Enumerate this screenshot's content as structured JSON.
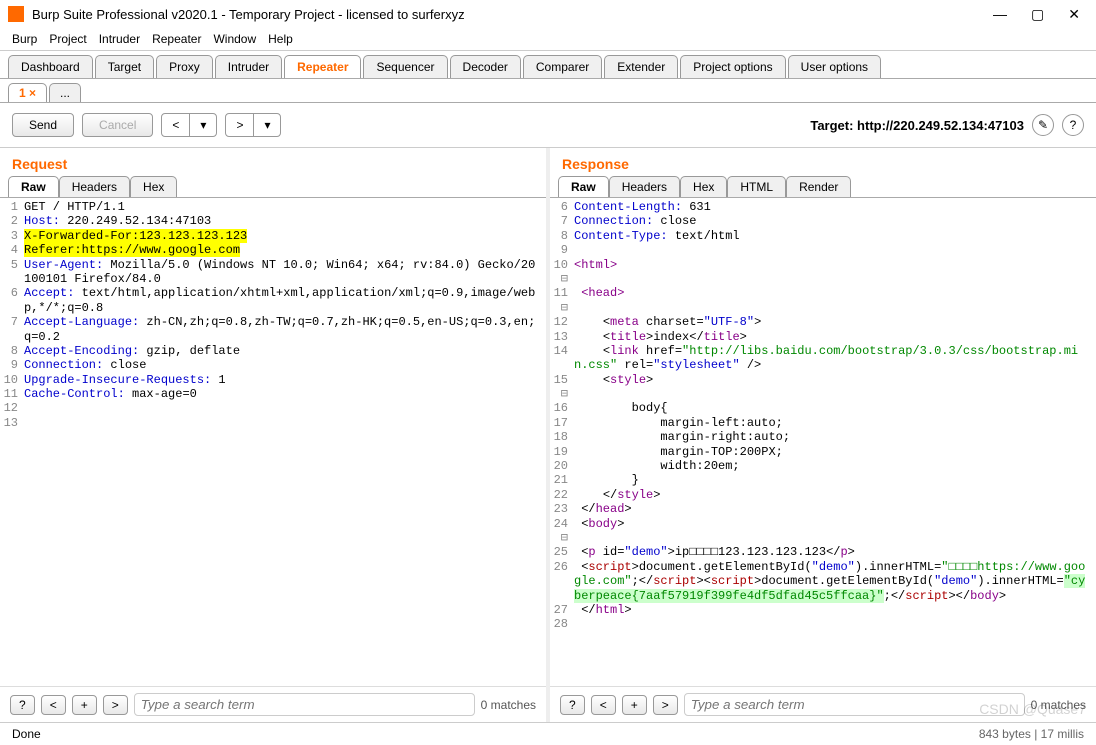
{
  "window": {
    "title": "Burp Suite Professional v2020.1 - Temporary Project - licensed to surferxyz"
  },
  "menubar": [
    "Burp",
    "Project",
    "Intruder",
    "Repeater",
    "Window",
    "Help"
  ],
  "main_tabs": [
    "Dashboard",
    "Target",
    "Proxy",
    "Intruder",
    "Repeater",
    "Sequencer",
    "Decoder",
    "Comparer",
    "Extender",
    "Project options",
    "User options"
  ],
  "active_main_tab": "Repeater",
  "sub_tabs": [
    "1 ×",
    "..."
  ],
  "active_sub_tab": "1 ×",
  "actions": {
    "send": "Send",
    "cancel": "Cancel",
    "target_label": "Target: http://220.249.52.134:47103"
  },
  "request": {
    "title": "Request",
    "view_tabs": [
      "Raw",
      "Headers",
      "Hex"
    ],
    "active_view": "Raw",
    "lines": [
      {
        "n": 1,
        "segs": [
          {
            "t": "GET / HTTP/1.1"
          }
        ]
      },
      {
        "n": 2,
        "segs": [
          {
            "t": "Host:",
            "c": "kw-blue"
          },
          {
            "t": " 220.249.52.134:47103"
          }
        ]
      },
      {
        "n": 3,
        "segs": [
          {
            "t": "X-Forwarded-For:123.123.123.123",
            "c": "hl"
          }
        ]
      },
      {
        "n": 4,
        "segs": [
          {
            "t": "Referer:https://www.google.com",
            "c": "hl"
          }
        ]
      },
      {
        "n": 5,
        "segs": [
          {
            "t": "User-Agent:",
            "c": "kw-blue"
          },
          {
            "t": " Mozilla/5.0 (Windows NT 10.0; Win64; x64; rv:84.0) Gecko/20100101 Firefox/84.0"
          }
        ]
      },
      {
        "n": 6,
        "segs": [
          {
            "t": "Accept:",
            "c": "kw-blue"
          },
          {
            "t": " text/html,application/xhtml+xml,application/xml;q=0.9,image/webp,*/*;q=0.8"
          }
        ]
      },
      {
        "n": 7,
        "segs": [
          {
            "t": "Accept-Language:",
            "c": "kw-blue"
          },
          {
            "t": " zh-CN,zh;q=0.8,zh-TW;q=0.7,zh-HK;q=0.5,en-US;q=0.3,en;q=0.2"
          }
        ]
      },
      {
        "n": 8,
        "segs": [
          {
            "t": "Accept-Encoding:",
            "c": "kw-blue"
          },
          {
            "t": " gzip, deflate"
          }
        ]
      },
      {
        "n": 9,
        "segs": [
          {
            "t": "Connection:",
            "c": "kw-blue"
          },
          {
            "t": " close"
          }
        ]
      },
      {
        "n": 10,
        "segs": [
          {
            "t": "Upgrade-Insecure-Requests:",
            "c": "kw-blue"
          },
          {
            "t": " 1"
          }
        ]
      },
      {
        "n": 11,
        "segs": [
          {
            "t": "Cache-Control:",
            "c": "kw-blue"
          },
          {
            "t": " max-age=0"
          }
        ]
      },
      {
        "n": 12,
        "segs": [
          {
            "t": ""
          }
        ]
      },
      {
        "n": 13,
        "segs": [
          {
            "t": ""
          }
        ]
      }
    ],
    "search_placeholder": "Type a search term",
    "matches": "0 matches"
  },
  "response": {
    "title": "Response",
    "view_tabs": [
      "Raw",
      "Headers",
      "Hex",
      "HTML",
      "Render"
    ],
    "active_view": "Raw",
    "lines": [
      {
        "n": 6,
        "segs": [
          {
            "t": "Content-Length:",
            "c": "kw-blue"
          },
          {
            "t": " 631"
          }
        ]
      },
      {
        "n": 7,
        "segs": [
          {
            "t": "Connection:",
            "c": "kw-blue"
          },
          {
            "t": " close"
          }
        ]
      },
      {
        "n": 8,
        "segs": [
          {
            "t": "Content-Type:",
            "c": "kw-blue"
          },
          {
            "t": " text/html"
          }
        ]
      },
      {
        "n": 9,
        "segs": [
          {
            "t": ""
          }
        ]
      },
      {
        "n": 10,
        "fold": true,
        "segs": [
          {
            "t": "<html>",
            "c": "kw-purple"
          }
        ]
      },
      {
        "n": 11,
        "fold": true,
        "segs": [
          {
            "t": " <head>",
            "c": "kw-purple"
          }
        ]
      },
      {
        "n": 12,
        "segs": [
          {
            "t": "    <"
          },
          {
            "t": "meta",
            "c": "kw-purple"
          },
          {
            "t": " charset="
          },
          {
            "t": "\"UTF-8\"",
            "c": "kw-blue"
          },
          {
            "t": ">"
          }
        ]
      },
      {
        "n": 13,
        "segs": [
          {
            "t": "    <"
          },
          {
            "t": "title",
            "c": "kw-purple"
          },
          {
            "t": ">index</"
          },
          {
            "t": "title",
            "c": "kw-purple"
          },
          {
            "t": ">"
          }
        ]
      },
      {
        "n": 14,
        "segs": [
          {
            "t": "    <"
          },
          {
            "t": "link",
            "c": "kw-purple"
          },
          {
            "t": " href="
          },
          {
            "t": "\"http://libs.baidu.com/bootstrap/3.0.3/css/bootstrap.min.css\"",
            "c": "kw-green"
          },
          {
            "t": " rel="
          },
          {
            "t": "\"stylesheet\"",
            "c": "kw-blue"
          },
          {
            "t": " />"
          }
        ]
      },
      {
        "n": 15,
        "fold": true,
        "segs": [
          {
            "t": "    <"
          },
          {
            "t": "style",
            "c": "kw-purple"
          },
          {
            "t": ">"
          }
        ]
      },
      {
        "n": 16,
        "segs": [
          {
            "t": "        body{"
          }
        ]
      },
      {
        "n": 17,
        "segs": [
          {
            "t": "            margin-left:auto;"
          }
        ]
      },
      {
        "n": 18,
        "segs": [
          {
            "t": "            margin-right:auto;"
          }
        ]
      },
      {
        "n": 19,
        "segs": [
          {
            "t": "            margin-TOP:200PX;"
          }
        ]
      },
      {
        "n": 20,
        "segs": [
          {
            "t": "            width:20em;"
          }
        ]
      },
      {
        "n": 21,
        "segs": [
          {
            "t": "        }"
          }
        ]
      },
      {
        "n": 22,
        "segs": [
          {
            "t": "    </"
          },
          {
            "t": "style",
            "c": "kw-purple"
          },
          {
            "t": ">"
          }
        ]
      },
      {
        "n": 23,
        "segs": [
          {
            "t": " </"
          },
          {
            "t": "head",
            "c": "kw-purple"
          },
          {
            "t": ">"
          }
        ]
      },
      {
        "n": 24,
        "fold": true,
        "segs": [
          {
            "t": " <"
          },
          {
            "t": "body",
            "c": "kw-purple"
          },
          {
            "t": ">"
          }
        ]
      },
      {
        "n": 25,
        "segs": [
          {
            "t": " <"
          },
          {
            "t": "p",
            "c": "kw-purple"
          },
          {
            "t": " id="
          },
          {
            "t": "\"demo\"",
            "c": "kw-blue"
          },
          {
            "t": ">ip□□□□123.123.123.123</"
          },
          {
            "t": "p",
            "c": "kw-purple"
          },
          {
            "t": ">"
          }
        ]
      },
      {
        "n": 26,
        "segs": [
          {
            "t": " <"
          },
          {
            "t": "script",
            "c": "kw-red"
          },
          {
            "t": ">document.getElementById("
          },
          {
            "t": "\"demo\"",
            "c": "kw-blue"
          },
          {
            "t": ").innerHTML="
          },
          {
            "t": "\"□□□□https://www.google.com\"",
            "c": "kw-green"
          },
          {
            "t": ";</"
          },
          {
            "t": "script",
            "c": "kw-red"
          },
          {
            "t": "><"
          },
          {
            "t": "script",
            "c": "kw-red"
          },
          {
            "t": ">document.getElementById("
          },
          {
            "t": "\"demo\"",
            "c": "kw-blue"
          },
          {
            "t": ").innerHTML="
          },
          {
            "t": "\"cyberpeace{7aaf57919f399fe4df5dfad45c5ffcaa}\"",
            "c": "kw-green hl-green"
          },
          {
            "t": ";</"
          },
          {
            "t": "script",
            "c": "kw-red"
          },
          {
            "t": "></"
          },
          {
            "t": "body",
            "c": "kw-purple"
          },
          {
            "t": ">"
          }
        ]
      },
      {
        "n": 27,
        "segs": [
          {
            "t": " </"
          },
          {
            "t": "html",
            "c": "kw-purple"
          },
          {
            "t": ">"
          }
        ]
      },
      {
        "n": 28,
        "segs": [
          {
            "t": ""
          }
        ]
      }
    ],
    "search_placeholder": "Type a search term",
    "matches": "0 matches"
  },
  "status": {
    "left": "Done",
    "right": "843 bytes | 17 millis"
  },
  "watermark": "CSDN @Quase7"
}
